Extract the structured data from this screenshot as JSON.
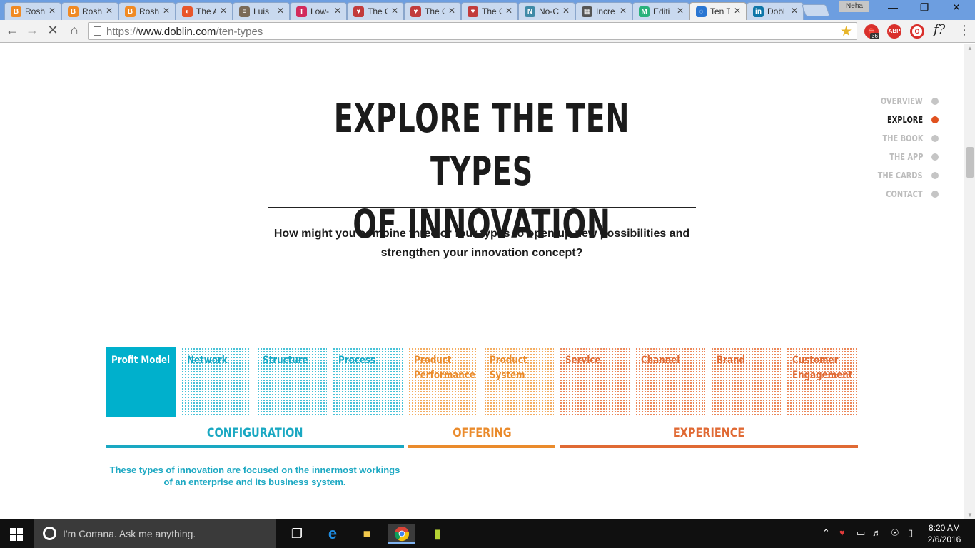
{
  "browser": {
    "tabs": [
      {
        "title": "Rosh",
        "fav_color": "#f08a24",
        "fav_glyph": "B"
      },
      {
        "title": "Rosh",
        "fav_color": "#f08a24",
        "fav_glyph": "B"
      },
      {
        "title": "Rosh",
        "fav_color": "#f08a24",
        "fav_glyph": "B"
      },
      {
        "title": "The A",
        "fav_color": "#e8562a",
        "fav_glyph": "◐"
      },
      {
        "title": "Luis",
        "fav_color": "#7a6a58",
        "fav_glyph": "≡"
      },
      {
        "title": "Low-",
        "fav_color": "#d22a5c",
        "fav_glyph": "T"
      },
      {
        "title": "The G",
        "fav_color": "#c23b3b",
        "fav_glyph": "♥"
      },
      {
        "title": "The G",
        "fav_color": "#c23b3b",
        "fav_glyph": "♥"
      },
      {
        "title": "The G",
        "fav_color": "#c23b3b",
        "fav_glyph": "♥"
      },
      {
        "title": "No-C",
        "fav_color": "#3f8aa7",
        "fav_glyph": "N"
      },
      {
        "title": "Incre",
        "fav_color": "#555555",
        "fav_glyph": "▦"
      },
      {
        "title": "Editi",
        "fav_color": "#2ab27b",
        "fav_glyph": "M"
      },
      {
        "title": "Ten T",
        "fav_color": "#2a76d2",
        "fav_glyph": "◌"
      },
      {
        "title": "Dobl",
        "fav_color": "#0e76a8",
        "fav_glyph": "in"
      }
    ],
    "active_tab": 12,
    "profile_name": "Neha",
    "url_prefix": "https://",
    "url_host": "www.doblin.com",
    "url_path": "/ten-types",
    "ext_badge": "36",
    "ext_abp": "ABP",
    "ext_f": "f?"
  },
  "page": {
    "headline_line1": "EXPLORE THE TEN TYPES",
    "headline_line2": "OF INNOVATION",
    "question": "How might you combine three or four types to open up new possibilities and strengthen your innovation concept?",
    "side_nav": [
      {
        "label": "OVERVIEW",
        "active": false
      },
      {
        "label": "EXPLORE",
        "active": true
      },
      {
        "label": "THE BOOK",
        "active": false
      },
      {
        "label": "THE APP",
        "active": false
      },
      {
        "label": "THE CARDS",
        "active": false
      },
      {
        "label": "CONTACT",
        "active": false
      }
    ],
    "tiles": [
      {
        "label": "Profit Model",
        "group": "configuration",
        "selected": true
      },
      {
        "label": "Network",
        "group": "configuration",
        "selected": false
      },
      {
        "label": "Structure",
        "group": "configuration",
        "selected": false
      },
      {
        "label": "Process",
        "group": "configuration",
        "selected": false
      },
      {
        "label": "Product Performance",
        "group": "offering",
        "selected": false
      },
      {
        "label": "Product System",
        "group": "offering",
        "selected": false
      },
      {
        "label": "Service",
        "group": "experience",
        "selected": false
      },
      {
        "label": "Channel",
        "group": "experience",
        "selected": false
      },
      {
        "label": "Brand",
        "group": "experience",
        "selected": false
      },
      {
        "label": "Customer Engagement",
        "group": "experience",
        "selected": false
      }
    ],
    "categories": {
      "configuration": {
        "label": "CONFIGURATION",
        "color": "#1aa8c2"
      },
      "offering": {
        "label": "OFFERING",
        "color": "#ea8b2c"
      },
      "experience": {
        "label": "EXPERIENCE",
        "color": "#e06a34"
      }
    },
    "description": "These types of innovation are focused on the innermost workings of an enterprise and its business system."
  },
  "taskbar": {
    "cortana_placeholder": "I'm Cortana. Ask me anything.",
    "time": "8:20 AM",
    "date": "2/6/2016"
  }
}
